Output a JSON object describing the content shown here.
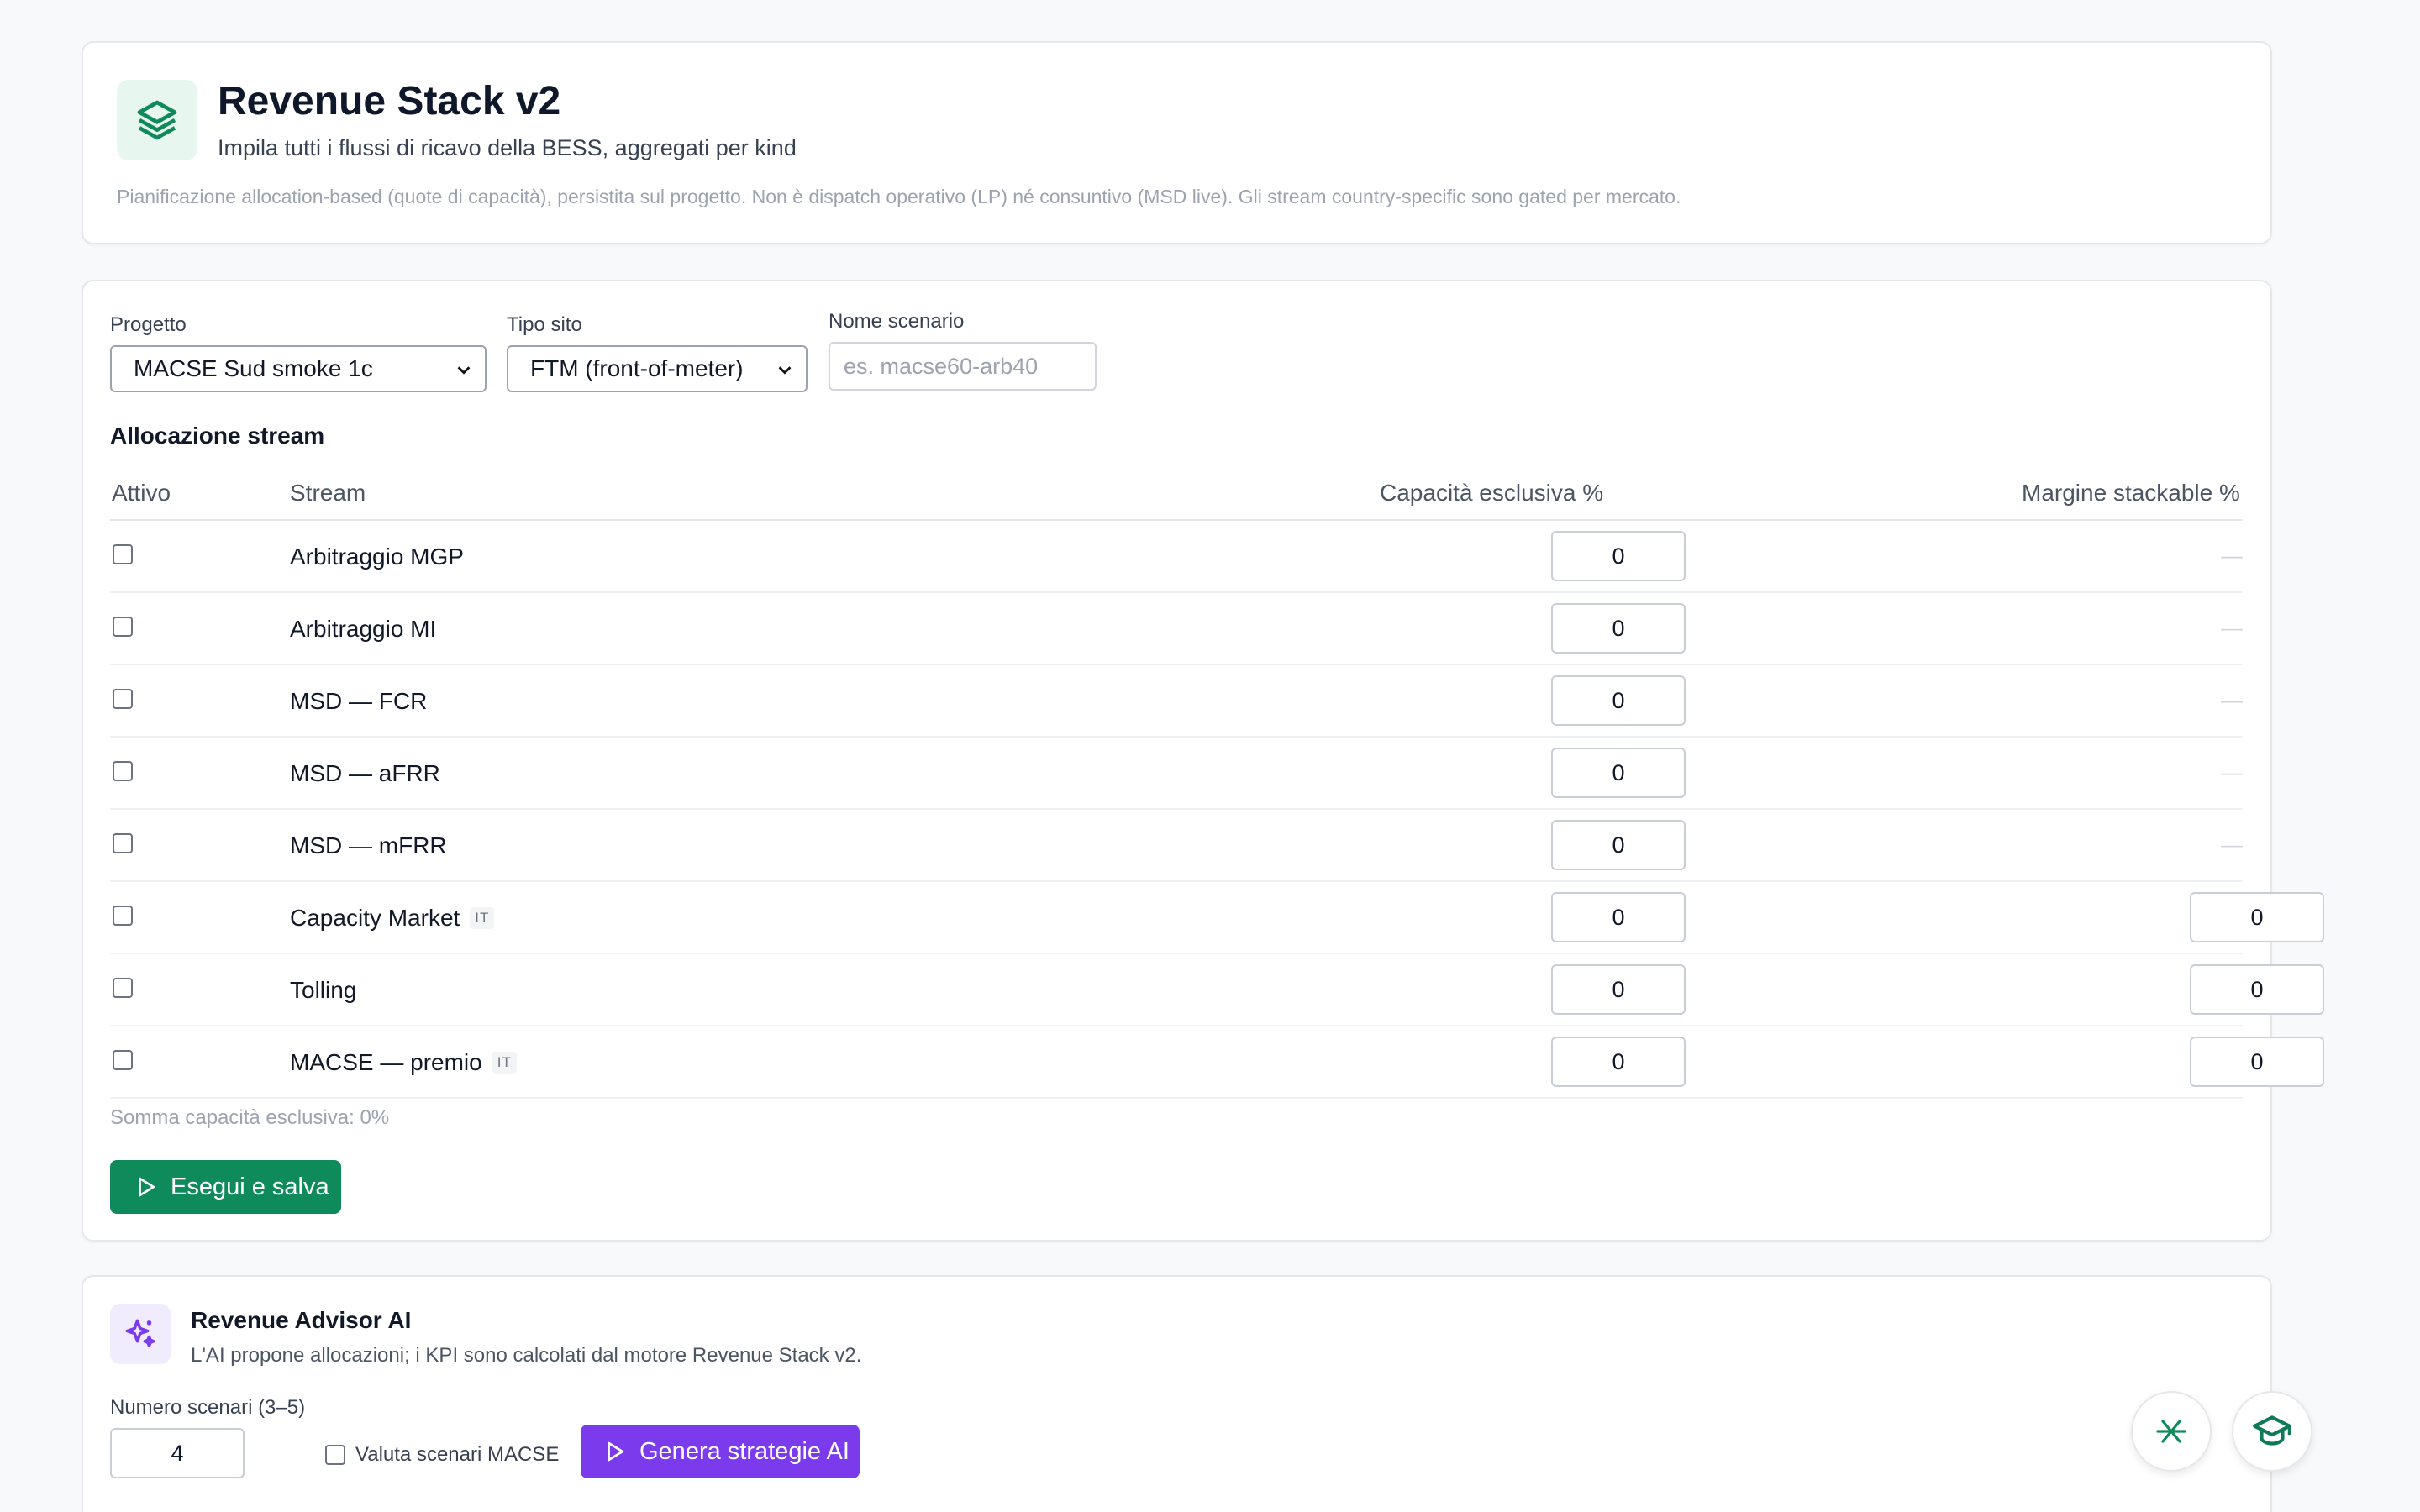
{
  "header": {
    "title": "Revenue Stack v2",
    "subtitle": "Impila tutti i flussi di ricavo della BESS, aggregati per kind",
    "note": "Pianificazione allocation-based (quote di capacità), persistita sul progetto. Non è dispatch operativo (LP) né consuntivo (MSD live). Gli stream country-specific sono gated per mercato.",
    "icon": "layers-icon"
  },
  "form": {
    "project_label": "Progetto",
    "project_value": "MACSE Sud smoke 1c",
    "site_label": "Tipo sito",
    "site_value": "FTM (front-of-meter)",
    "scenario_label": "Nome scenario",
    "scenario_placeholder": "es. macse60-arb40"
  },
  "allocation": {
    "title": "Allocazione stream",
    "columns": {
      "active": "Attivo",
      "stream": "Stream",
      "exclusive": "Capacità esclusiva %",
      "stackable": "Margine stackable %"
    },
    "rows": [
      {
        "name": "Arbitraggio MGP",
        "tag": "",
        "exclusive": "0",
        "stackable": "—"
      },
      {
        "name": "Arbitraggio MI",
        "tag": "",
        "exclusive": "0",
        "stackable": "—"
      },
      {
        "name": "MSD — FCR",
        "tag": "",
        "exclusive": "0",
        "stackable": "—"
      },
      {
        "name": "MSD — aFRR",
        "tag": "",
        "exclusive": "0",
        "stackable": "—"
      },
      {
        "name": "MSD — mFRR",
        "tag": "",
        "exclusive": "0",
        "stackable": "—"
      },
      {
        "name": "Capacity Market",
        "tag": "IT",
        "exclusive": "0",
        "stackable": "0"
      },
      {
        "name": "Tolling",
        "tag": "",
        "exclusive": "0",
        "stackable": "0"
      },
      {
        "name": "MACSE — premio",
        "tag": "IT",
        "exclusive": "0",
        "stackable": "0"
      }
    ],
    "sum_note": "Somma capacità esclusiva: 0%",
    "run_button": "Esegui e salva"
  },
  "advisor": {
    "title": "Revenue Advisor AI",
    "subtitle": "L'AI propone allocazioni; i KPI sono calcolati dal motore Revenue Stack v2.",
    "scenarios_label": "Numero scenari (3–5)",
    "scenarios_value": "4",
    "macse_check_label": "Valuta scenari MACSE",
    "generate_button": "Genera strategie AI"
  },
  "colors": {
    "primary": "#0e8a5b",
    "ai_accent": "#7c3aed"
  }
}
